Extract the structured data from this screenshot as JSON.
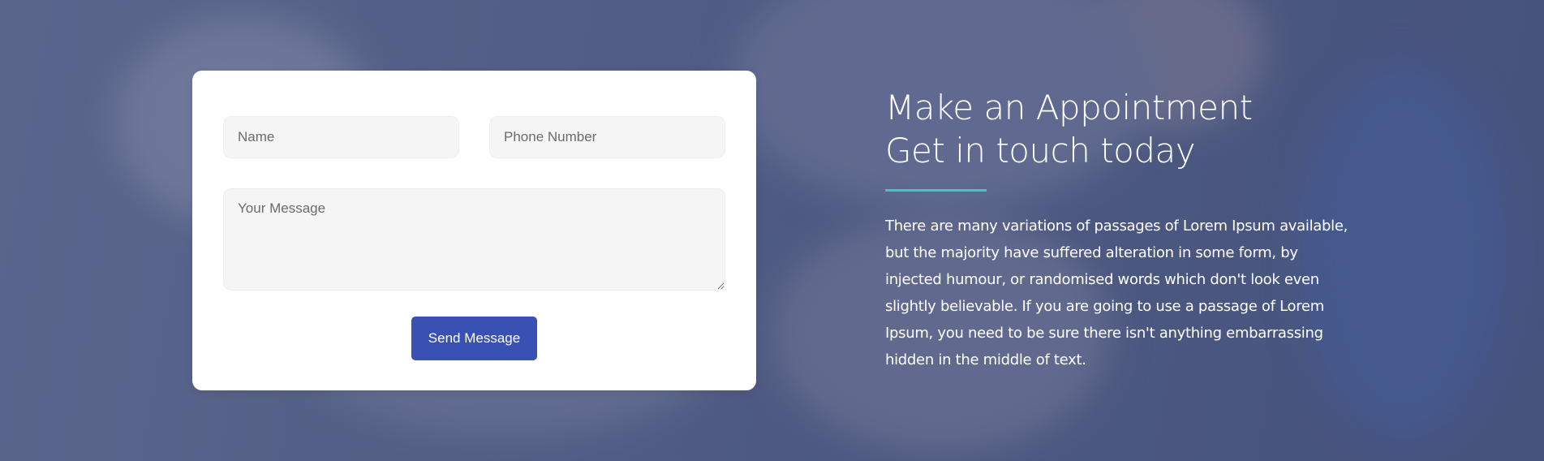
{
  "form": {
    "name_placeholder": "Name",
    "phone_placeholder": "Phone Number",
    "message_placeholder": "Your Message",
    "send_label": "Send Message"
  },
  "info": {
    "heading_line1": "Make an Appointment",
    "heading_line2": "Get in touch today",
    "description": "There are many variations of passages of Lorem Ipsum available, but the majority have suffered alteration in some form, by injected humour, or randomised words which don't look even slightly believable. If you are going to use a passage of Lorem Ipsum, you need to be sure there isn't anything embarrassing hidden in the middle of text."
  },
  "colors": {
    "overlay": "#4a5580",
    "card_background": "#ffffff",
    "field_background": "#f5f5f5",
    "button": "#3951b3",
    "accent_line": "#3cc8c8"
  }
}
